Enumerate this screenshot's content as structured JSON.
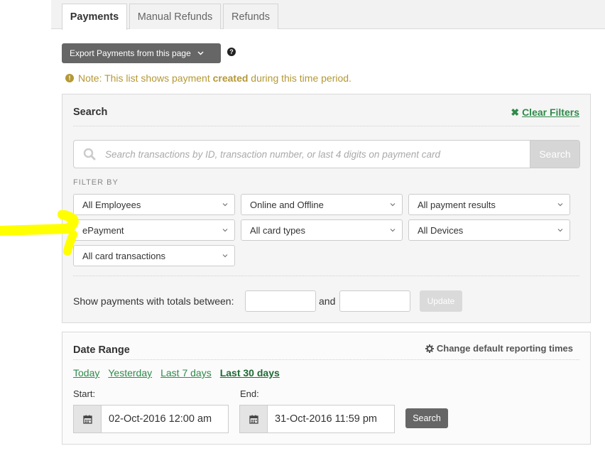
{
  "tabs": [
    {
      "label": "Payments",
      "active": true
    },
    {
      "label": "Manual Refunds",
      "active": false
    },
    {
      "label": "Refunds",
      "active": false
    }
  ],
  "export": {
    "label": "Export Payments from this page",
    "icon": "chevron-down-icon"
  },
  "help_icon": "question-circle-icon",
  "note": {
    "prefix": "Note: This list shows payment ",
    "bold": "created",
    "suffix": " during this time period."
  },
  "search_panel": {
    "title": "Search",
    "clear_filters": "Clear Filters",
    "search": {
      "placeholder": "Search transactions by ID, transaction number, or last 4 digits on payment card",
      "value": "",
      "button": "Search"
    },
    "filter_by": "FILTER BY",
    "filters": {
      "employees": "All Employees",
      "channel": "Online and Offline",
      "results": "All payment results",
      "payment_type": "ePayment",
      "card_types": "All card types",
      "devices": "All Devices",
      "card_transactions": "All card transactions"
    },
    "totals": {
      "label": "Show payments with totals between:",
      "min": "",
      "and": "and",
      "max": "",
      "update": "Update"
    }
  },
  "date_panel": {
    "title": "Date Range",
    "change_times": "Change default reporting times",
    "ranges": [
      {
        "label": "Today",
        "selected": false
      },
      {
        "label": "Yesterday",
        "selected": false
      },
      {
        "label": "Last 7 days",
        "selected": false
      },
      {
        "label": "Last 30 days",
        "selected": true
      }
    ],
    "start_label": "Start:",
    "start_value": "02-Oct-2016 12:00 am",
    "end_label": "End:",
    "end_value": "31-Oct-2016 11:59 pm",
    "search": "Search"
  },
  "colors": {
    "accent_green": "#2f8a4a",
    "note_gold": "#b49836",
    "button_gray": "#666666",
    "highlight_yellow": "#ffff00"
  }
}
